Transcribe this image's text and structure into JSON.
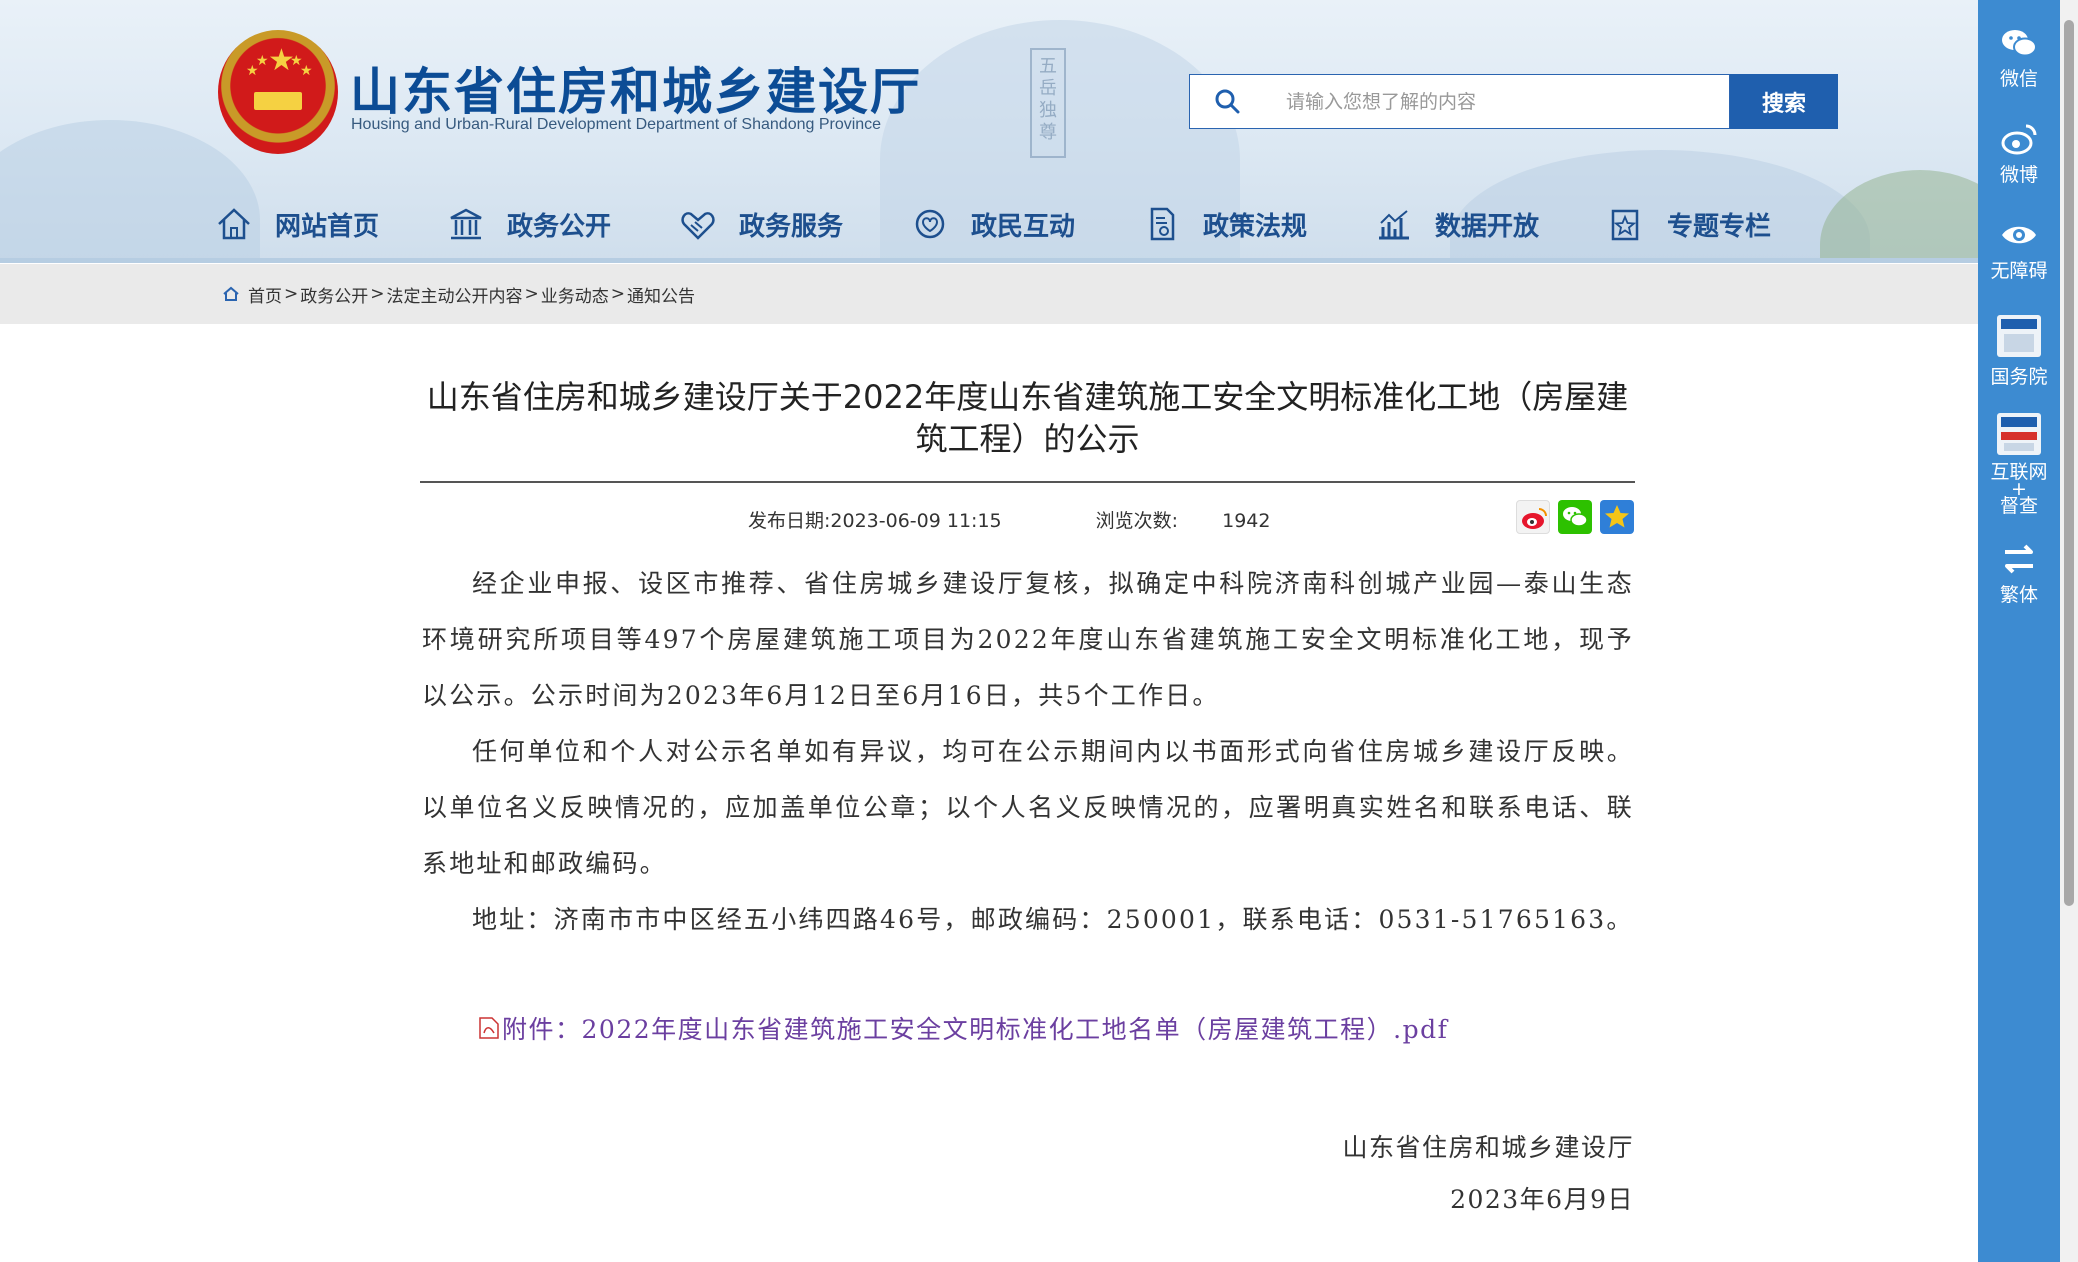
{
  "header": {
    "site_title": "山东省住房和城乡建设厅",
    "site_subtitle": "Housing and Urban-Rural Development Department of Shandong Province",
    "search_placeholder": "请输入您想了解的内容",
    "search_button": "搜索"
  },
  "nav": [
    {
      "label": "网站首页",
      "icon": "home-icon"
    },
    {
      "label": "政务公开",
      "icon": "government-building-icon"
    },
    {
      "label": "政务服务",
      "icon": "handshake-icon"
    },
    {
      "label": "政民互动",
      "icon": "interaction-icon"
    },
    {
      "label": "政策法规",
      "icon": "policy-document-icon"
    },
    {
      "label": "数据开放",
      "icon": "data-chart-icon"
    },
    {
      "label": "专题专栏",
      "icon": "topic-star-icon"
    }
  ],
  "breadcrumb": [
    "首页",
    "政务公开",
    "法定主动公开内容",
    "业务动态",
    "通知公告"
  ],
  "article": {
    "title": "山东省住房和城乡建设厅关于2022年度山东省建筑施工安全文明标准化工地（房屋建筑工程）的公示",
    "publish_label": "发布日期:2023-06-09 11:15",
    "views_label": "浏览次数:",
    "views_value": "1942",
    "paragraphs": [
      "经企业申报、设区市推荐、省住房城乡建设厅复核，拟确定中科院济南科创城产业园—泰山生态环境研究所项目等497个房屋建筑施工项目为2022年度山东省建筑施工安全文明标准化工地，现予以公示。公示时间为2023年6月12日至6月16日，共5个工作日。",
      "任何单位和个人对公示名单如有异议，均可在公示期间内以书面形式向省住房城乡建设厅反映。以单位名义反映情况的，应加盖单位公章；以个人名义反映情况的，应署明真实姓名和联系电话、联系地址和邮政编码。",
      "地址：济南市市中区经五小纬四路46号，邮政编码：250001，联系电话：0531-51765163。"
    ],
    "attachment_prefix": "附件：",
    "attachment_link": "2022年度山东省建筑施工安全文明标准化工地名单（房屋建筑工程）.pdf",
    "signature_org": "山东省住房和城乡建设厅",
    "signature_date": "2023年6月9日"
  },
  "share_icons": [
    "weibo-share-icon",
    "wechat-share-icon",
    "favorite-star-icon"
  ],
  "sidebar": [
    {
      "label": "微信",
      "icon": "wechat-icon"
    },
    {
      "label": "微博",
      "icon": "weibo-icon"
    },
    {
      "label": "无障碍",
      "icon": "accessibility-eye-icon"
    },
    {
      "label": "国务院",
      "icon": "state-council-icon"
    },
    {
      "label": "互联网+督查",
      "line1": "互联网",
      "line2": "+",
      "line3": "督查",
      "icon": "internet-supervision-icon"
    },
    {
      "label": "繁体",
      "icon": "traditional-chinese-switch-icon"
    }
  ],
  "colors": {
    "brand_blue": "#0c4c95",
    "nav_blue": "#1d4f8e",
    "sidebar_blue": "#3d8bd1",
    "search_button": "#1f5fae",
    "attachment_link": "#6b3fa0"
  }
}
